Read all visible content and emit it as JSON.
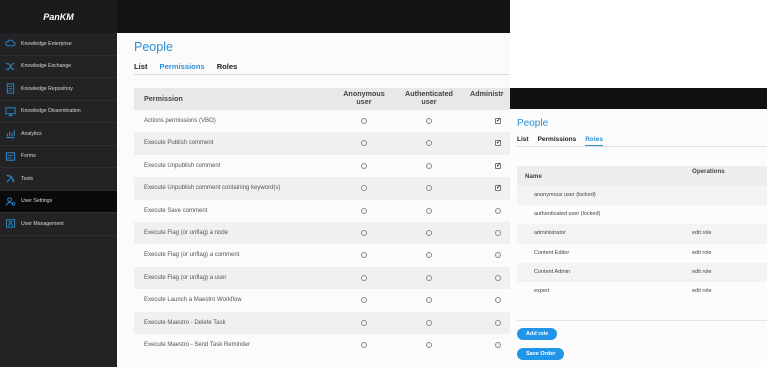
{
  "brand": {
    "name": "PanKM"
  },
  "sidebar": {
    "items": [
      {
        "label": "Knowledge Enterprise",
        "icon": "cloud-icon"
      },
      {
        "label": "Knowledge Exchange",
        "icon": "shuffle-icon"
      },
      {
        "label": "Knowledge Repository",
        "icon": "document-icon"
      },
      {
        "label": "Knowledge Dissemination",
        "icon": "monitor-icon"
      },
      {
        "label": "Analytics",
        "icon": "chart-icon"
      },
      {
        "label": "Forms",
        "icon": "form-icon"
      },
      {
        "label": "Tools",
        "icon": "tools-icon"
      },
      {
        "label": "User Settings",
        "icon": "user-settings-icon"
      },
      {
        "label": "User Management",
        "icon": "users-icon"
      }
    ],
    "active_index": 7
  },
  "people": {
    "title": "People",
    "tabs": [
      "List",
      "Permissions",
      "Roles"
    ],
    "active_tab": "Permissions",
    "columns": [
      "Permission",
      "Anonymous user",
      "Authenticated user",
      "Administr"
    ],
    "rows": [
      {
        "name": "Actions permissions (VBO)",
        "admin": true
      },
      {
        "name": "Execute Publish comment",
        "admin": true
      },
      {
        "name": "Execute Unpublish comment",
        "admin": true
      },
      {
        "name": "Execute Unpublish comment containing keyword(s)",
        "admin": true
      },
      {
        "name": "Execute Save comment",
        "admin": false
      },
      {
        "name": "Execute Flag (or unflag) a node",
        "admin": false
      },
      {
        "name": "Execute Flag (or unflag) a comment",
        "admin": false
      },
      {
        "name": "Execute Flag (or unflag) a user",
        "admin": false
      },
      {
        "name": "Execute Launch a Maestro Workflow",
        "admin": false
      },
      {
        "name": "Execute Maestro - Delete Task",
        "admin": false
      },
      {
        "name": "Execute Maestro - Send Task Reminder",
        "admin": false
      }
    ]
  },
  "roles": {
    "title": "People",
    "tabs": [
      "List",
      "Permissions",
      "Roles"
    ],
    "active_tab": "Roles",
    "columns": [
      "Name",
      "Operations"
    ],
    "rows": [
      {
        "name": "anonymous user (locked)",
        "op": ""
      },
      {
        "name": "authenticated user (locked)",
        "op": ""
      },
      {
        "name": "administrator",
        "op": "edit role"
      },
      {
        "name": "Content Editor",
        "op": "edit role"
      },
      {
        "name": "Content Admin",
        "op": "edit role"
      },
      {
        "name": "expert",
        "op": "edit role"
      }
    ],
    "add_label": "Add role",
    "save_label": "Save Order"
  },
  "colors": {
    "accent": "#2a8fd6",
    "button": "#2196e8",
    "sidebar": "#232325"
  }
}
